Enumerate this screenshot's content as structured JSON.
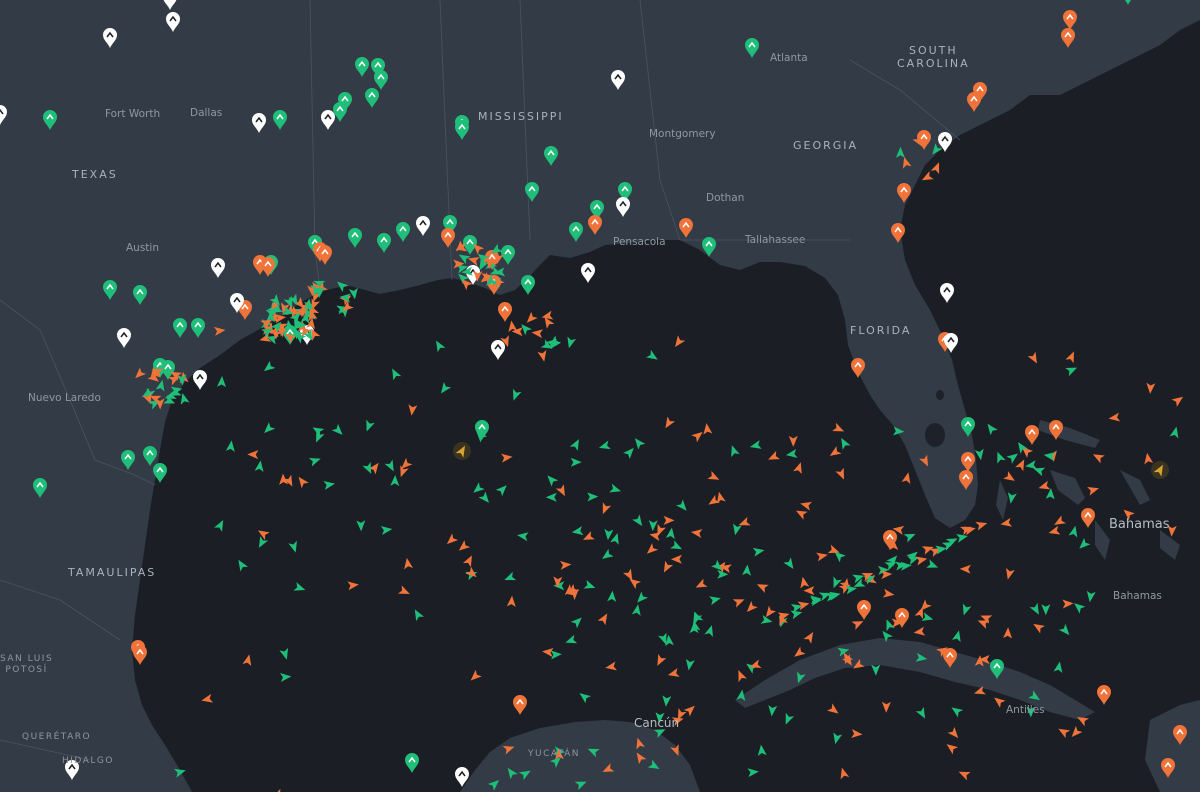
{
  "map": {
    "colors": {
      "water": "#1b1f25",
      "land": "#333b47",
      "lake": "#1d222a",
      "border": "#4a5360",
      "vessel_green": "#1fbf7a",
      "vessel_orange": "#f0733a",
      "port_white": "#ffffff",
      "vessel_amber": "#d9a233"
    },
    "labels": {
      "texas": "TEXAS",
      "mississippi": "MISSISSIPPI",
      "georgia": "GEORGIA",
      "south_carolina": "SOUTH\nCAROLINA",
      "florida": "FLORIDA",
      "tamaulipas": "TAMAULIPAS",
      "san_luis_potosi": "SAN LUIS\nPOTOSÍ",
      "queretaro": "QUERÉTARO",
      "hidalgo": "HIDALGO",
      "yucatan": "YUCATÁN",
      "fort_worth": "Fort Worth",
      "dallas": "Dallas",
      "austin": "Austin",
      "nuevo_laredo": "Nuevo Laredo",
      "atlanta": "Atlanta",
      "montgomery": "Montgomery",
      "dothan": "Dothan",
      "pensacola": "Pensacola",
      "tallahassee": "Tallahassee",
      "cancun": "Cancún",
      "bahamas_country": "Bahamas",
      "bahamas_small": "Bahamas",
      "antilles": "Antilles"
    },
    "legend_types": [
      "cargo-vessel",
      "tanker-vessel",
      "port-anchorage",
      "unknown-vessel"
    ]
  }
}
